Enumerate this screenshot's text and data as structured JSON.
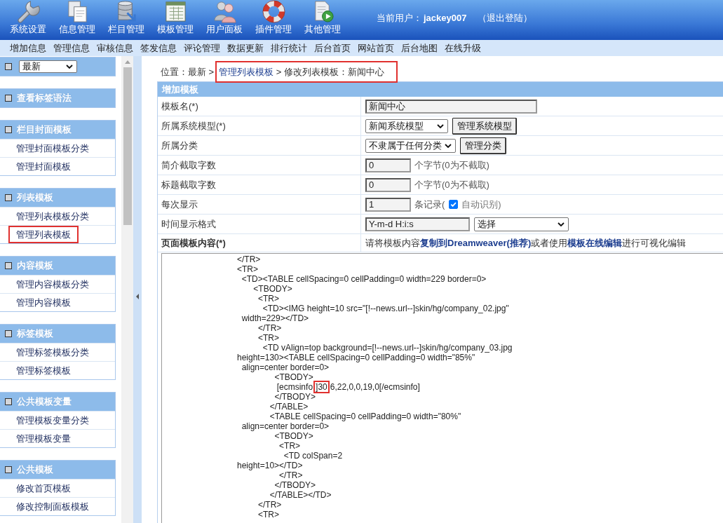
{
  "top_menu": [
    {
      "label": "系统设置"
    },
    {
      "label": "信息管理"
    },
    {
      "label": "栏目管理"
    },
    {
      "label": "模板管理"
    },
    {
      "label": "用户面板"
    },
    {
      "label": "插件管理"
    },
    {
      "label": "其他管理"
    }
  ],
  "user": {
    "label": "当前用户：",
    "name": "jackey007",
    "logout": "（退出登陆）"
  },
  "sub_menu": [
    "增加信息",
    "管理信息",
    "审核信息",
    "签发信息",
    "评论管理",
    "数据更新",
    "排行统计",
    "后台首页",
    "网站首页",
    "后台地图",
    "在线升级"
  ],
  "sidebar": {
    "filter": {
      "value": "最新"
    },
    "panels": [
      {
        "title": "查看标签语法"
      },
      {
        "title": "栏目封面模板",
        "items": [
          {
            "label": "管理封面模板分类",
            "highlighted": false
          },
          {
            "label": "管理封面模板",
            "highlighted": false
          }
        ]
      },
      {
        "title": "列表模板",
        "items": [
          {
            "label": "管理列表模板分类",
            "highlighted": false
          },
          {
            "label": "管理列表模板",
            "highlighted": true
          }
        ]
      },
      {
        "title": "内容模板",
        "items": [
          {
            "label": "管理内容模板分类",
            "highlighted": false
          },
          {
            "label": "管理内容模板",
            "highlighted": false
          }
        ]
      },
      {
        "title": "标签模板",
        "items": [
          {
            "label": "管理标签模板分类",
            "highlighted": false
          },
          {
            "label": "管理标签模板",
            "highlighted": false
          }
        ]
      },
      {
        "title": "公共模板变量",
        "items": [
          {
            "label": "管理模板变量分类",
            "highlighted": false
          },
          {
            "label": "管理模板变量",
            "highlighted": false
          }
        ]
      },
      {
        "title": "公共模板",
        "items": [
          {
            "label": "修改首页模板",
            "highlighted": false
          },
          {
            "label": "修改控制面板模板",
            "highlighted": false
          }
        ]
      }
    ]
  },
  "breadcrumb": {
    "prefix": "位置：最新 >",
    "link": "管理列表模板",
    "rest": "> 修改列表模板：新闻中心",
    "highlighted": true
  },
  "form": {
    "title": "增加模板",
    "rows": [
      {
        "label": "模板名(*)",
        "kind": "text",
        "value": "新闻中心"
      },
      {
        "label": "所属系统模型(*)",
        "kind": "select_button",
        "value": "新闻系统模型",
        "button": "管理系统模型"
      },
      {
        "label": "所属分类",
        "kind": "select_button",
        "value": "不隶属于任何分类",
        "button": "管理分类"
      },
      {
        "label": "简介截取字数",
        "kind": "number",
        "value": "0",
        "suffix": "个字节(0为不截取)"
      },
      {
        "label": "标题截取字数",
        "kind": "number",
        "value": "0",
        "suffix": "个字节(0为不截取)"
      },
      {
        "label": "每次显示",
        "kind": "number_check",
        "value": "1",
        "suffix": "条记录(",
        "checkbox": {
          "label": "自动识别)",
          "checked": true
        }
      },
      {
        "label": "时间显示格式",
        "kind": "text_select",
        "value": "Y-m-d H:i:s",
        "select": "选择"
      },
      {
        "label": "页面模板内容(*)",
        "kind": "instruction",
        "parts": [
          {
            "text": "请将模板内容",
            "kind": "text"
          },
          {
            "text": "复制到Dreamweaver(推荐)",
            "kind": "link"
          },
          {
            "text": "或者使用",
            "kind": "text"
          },
          {
            "text": "模板在线编辑",
            "kind": "link"
          },
          {
            "text": "进行可视化编辑",
            "kind": "text"
          }
        ]
      }
    ]
  },
  "editor": {
    "lines": [
      {
        "segments": [
          {
            "text": "</TR>",
            "highlighted": false
          }
        ]
      },
      {
        "segments": [
          {
            "text": "<TR>",
            "highlighted": false
          }
        ]
      },
      {
        "segments": [
          {
            "text": "  <TD><TABLE cellSpacing=0 cellPadding=0 width=229 border=0>",
            "highlighted": false
          }
        ]
      },
      {
        "segments": [
          {
            "text": "       <TBODY>",
            "highlighted": false
          }
        ]
      },
      {
        "segments": [
          {
            "text": "         <TR>",
            "highlighted": false
          }
        ]
      },
      {
        "segments": [
          {
            "text": "           <TD><IMG height=10 src=\"[!--news.url--]skin/hg/company_02.jpg\"",
            "highlighted": false
          }
        ]
      },
      {
        "segments": [
          {
            "text": "  width=229></TD>",
            "highlighted": false
          }
        ]
      },
      {
        "segments": [
          {
            "text": "         </TR>",
            "highlighted": false
          }
        ]
      },
      {
        "segments": [
          {
            "text": "         <TR>",
            "highlighted": false
          }
        ]
      },
      {
        "segments": [
          {
            "text": "           <TD vAlign=top background=[!--news.url--]skin/hg/company_03.jpg",
            "highlighted": false
          }
        ]
      },
      {
        "segments": [
          {
            "text": "height=130><TABLE cellSpacing=0 cellPadding=0 width=\"85%\"",
            "highlighted": false
          }
        ]
      },
      {
        "segments": [
          {
            "text": "  align=center border=0>",
            "highlighted": false
          }
        ]
      },
      {
        "segments": [
          {
            "text": "                <TBODY>",
            "highlighted": false
          }
        ]
      },
      {
        "segments": [
          {
            "text": "                 [ecmsinfo",
            "highlighted": false
          },
          {
            "text": "]30",
            "highlighted": true
          },
          {
            "text": "6,22,0,0,19,0[/ecmsinfo]",
            "highlighted": false
          }
        ]
      },
      {
        "segments": [
          {
            "text": "                </TBODY>",
            "highlighted": false
          }
        ]
      },
      {
        "segments": [
          {
            "text": "              </TABLE>",
            "highlighted": false
          }
        ]
      },
      {
        "segments": [
          {
            "text": "              <TABLE cellSpacing=0 cellPadding=0 width=\"80%\"",
            "highlighted": false
          }
        ]
      },
      {
        "segments": [
          {
            "text": "  align=center border=0>",
            "highlighted": false
          }
        ]
      },
      {
        "segments": [
          {
            "text": "                <TBODY>",
            "highlighted": false
          }
        ]
      },
      {
        "segments": [
          {
            "text": "                  <TR>",
            "highlighted": false
          }
        ]
      },
      {
        "segments": [
          {
            "text": "                    <TD colSpan=2",
            "highlighted": false
          }
        ]
      },
      {
        "segments": [
          {
            "text": "height=10></TD>",
            "highlighted": false
          }
        ]
      },
      {
        "segments": [
          {
            "text": "                  </TR>",
            "highlighted": false
          }
        ]
      },
      {
        "segments": [
          {
            "text": "                </TBODY>",
            "highlighted": false
          }
        ]
      },
      {
        "segments": [
          {
            "text": "              </TABLE></TD>",
            "highlighted": false
          }
        ]
      },
      {
        "segments": [
          {
            "text": "         </TR>",
            "highlighted": false
          }
        ]
      },
      {
        "segments": [
          {
            "text": "         <TR>",
            "highlighted": false
          }
        ]
      }
    ]
  }
}
